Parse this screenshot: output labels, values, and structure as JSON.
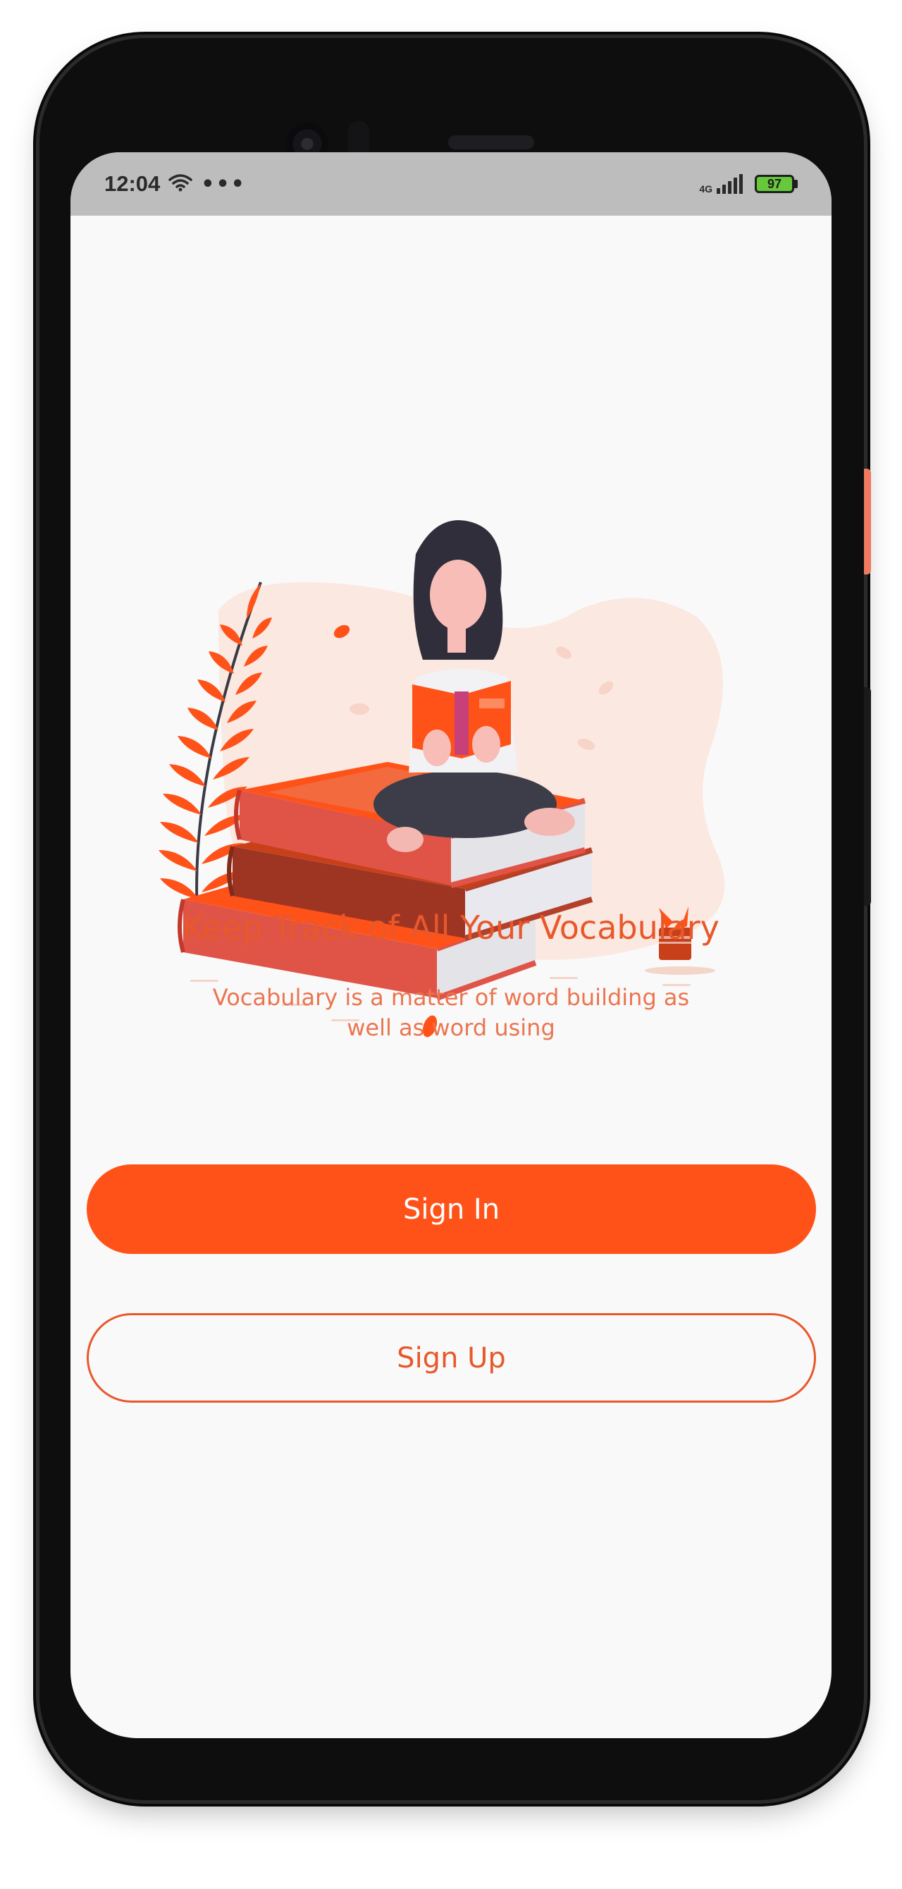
{
  "status_bar": {
    "time": "12:04",
    "network_label": "4G",
    "battery_level": "97",
    "icons": [
      "wifi-icon",
      "more-dots-icon",
      "signal-icon",
      "battery-icon"
    ]
  },
  "onboarding": {
    "headline": "Keep Track of All Your Vocabulary",
    "subtitle": "Vocabulary is a matter of word building as well as word using",
    "illustration_icon": "reading-person-on-books-illustration"
  },
  "actions": {
    "sign_in_label": "Sign In",
    "sign_up_label": "Sign Up"
  },
  "colors": {
    "accent": "#ff5219",
    "headline_text": "#e8582a",
    "status_bar_bg": "#bdbdbd",
    "screen_bg": "#f9f9f9"
  }
}
